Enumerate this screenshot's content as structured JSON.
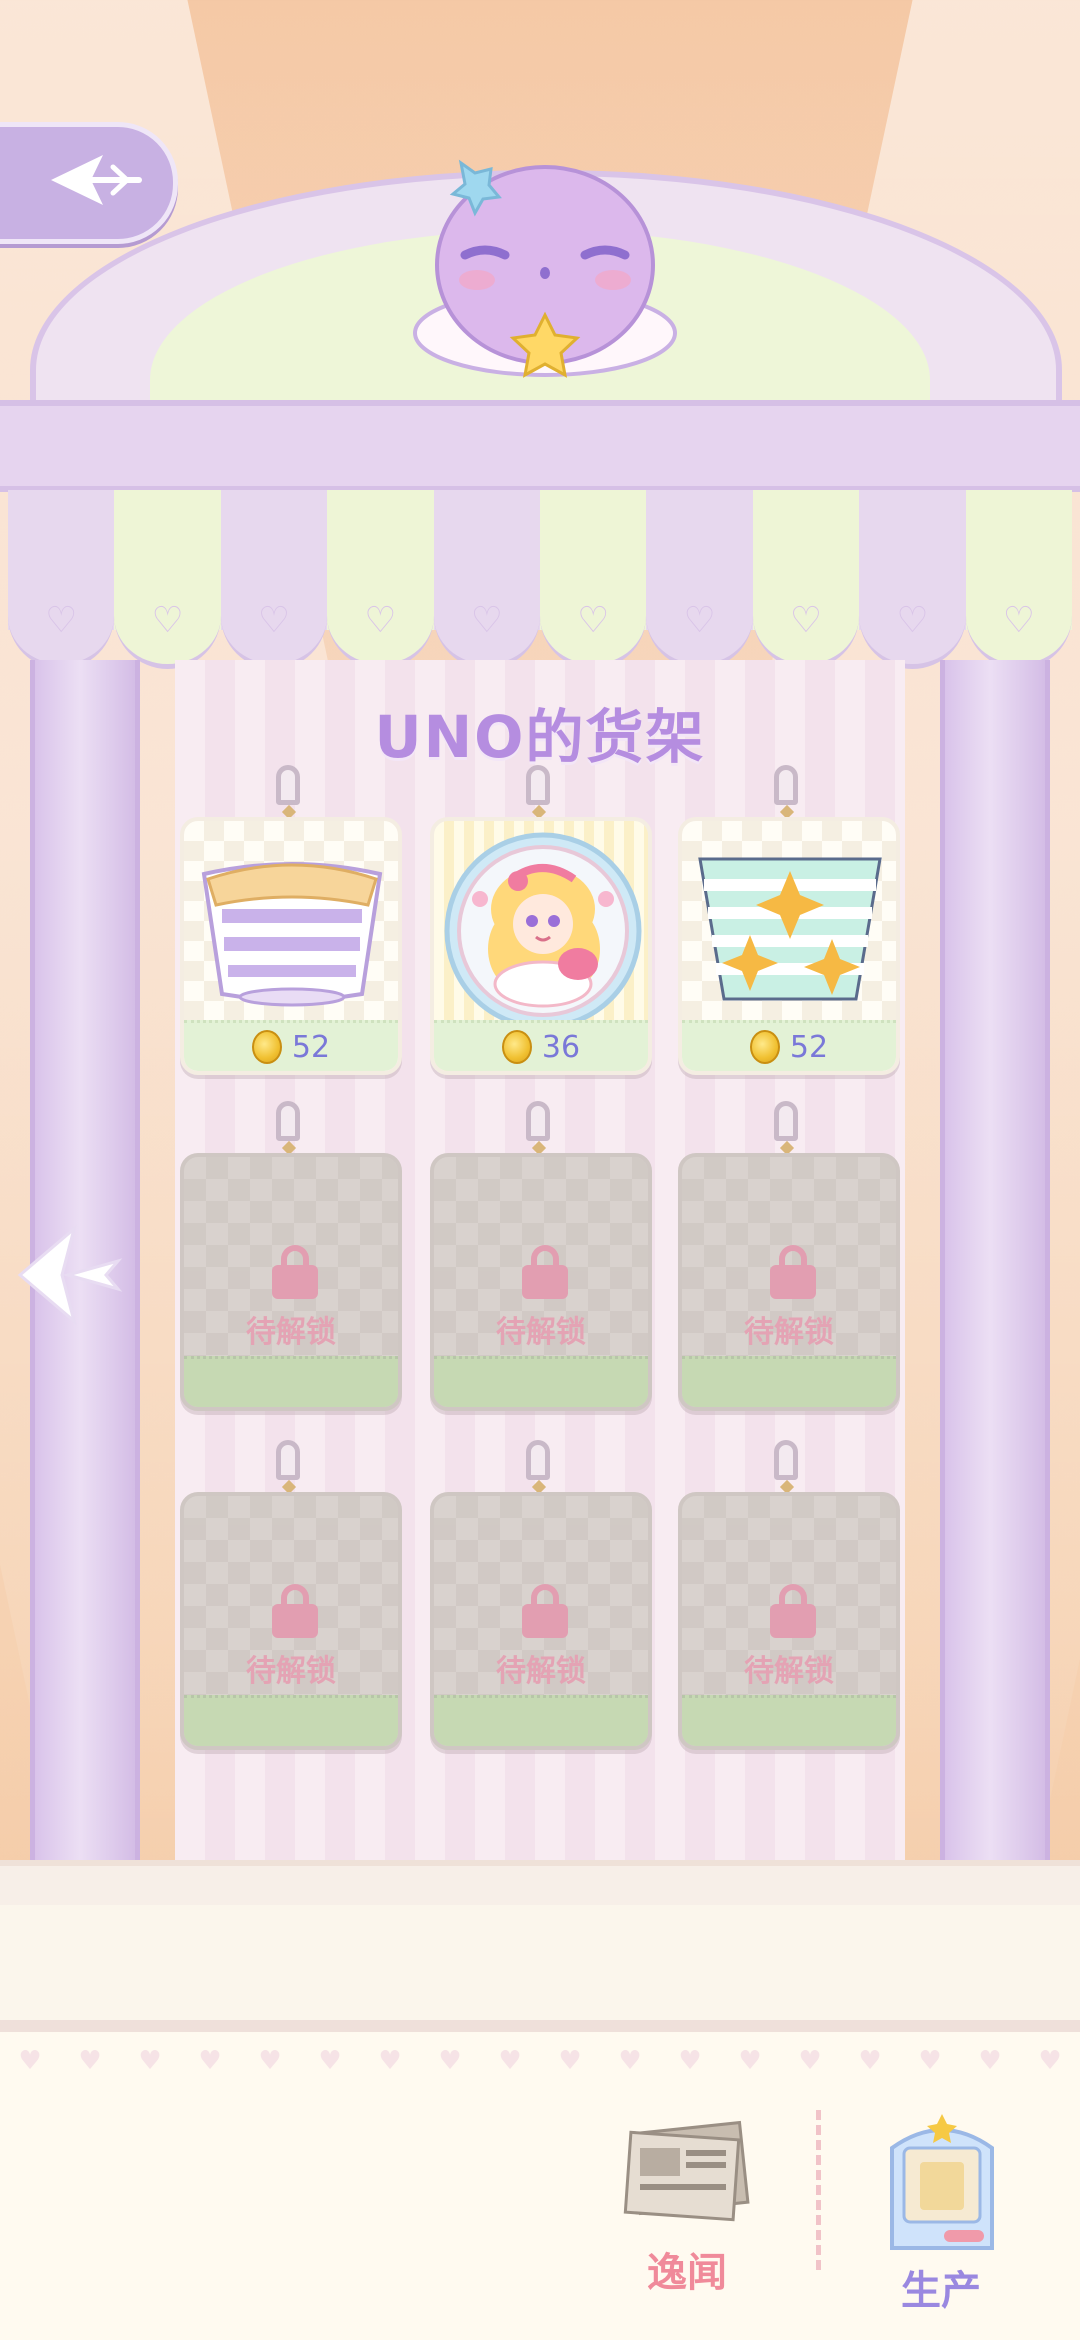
{
  "header": {
    "back_icon": "back-arrow-icon"
  },
  "shelf": {
    "title": "UNO的货架",
    "items": [
      {
        "state": "unlocked",
        "icon": "purple-striped-cup-icon",
        "price": "52"
      },
      {
        "state": "unlocked",
        "icon": "girl-portrait-badge-icon",
        "price": "36"
      },
      {
        "state": "unlocked",
        "icon": "mint-star-bucket-icon",
        "price": "52"
      },
      {
        "state": "locked",
        "lock_label": "待解锁"
      },
      {
        "state": "locked",
        "lock_label": "待解锁"
      },
      {
        "state": "locked",
        "lock_label": "待解锁"
      },
      {
        "state": "locked",
        "lock_label": "待解锁"
      },
      {
        "state": "locked",
        "lock_label": "待解锁"
      },
      {
        "state": "locked",
        "lock_label": "待解锁"
      }
    ]
  },
  "bottom_nav": {
    "news_label": "逸闻",
    "produce_label": "生产"
  },
  "colors": {
    "title": "#b58de0",
    "price": "#7a78d8",
    "lock": "#e29eb1",
    "news_label": "#f08a9a",
    "produce_label": "#9a88e0"
  }
}
